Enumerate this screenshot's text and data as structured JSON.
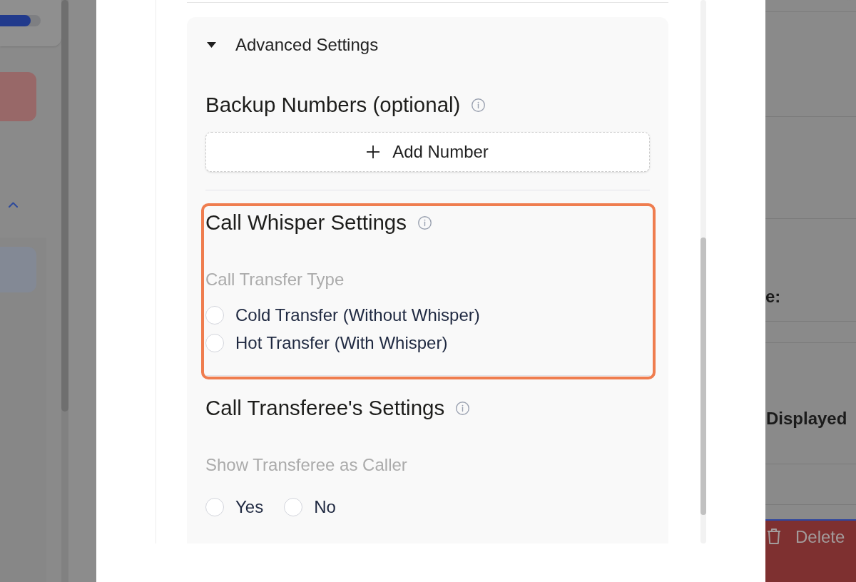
{
  "background_left": {
    "progress_bar": {
      "level": 0.75
    }
  },
  "modal": {
    "advanced_settings": {
      "label": "Advanced Settings",
      "expanded": true
    },
    "backup_numbers": {
      "title": "Backup Numbers (optional)",
      "add_button": "Add Number"
    },
    "call_whisper_settings": {
      "title": "Call Whisper Settings",
      "highlighted": true,
      "field_label": "Call Transfer Type",
      "options": [
        {
          "label": "Cold Transfer (Without Whisper)",
          "selected": false
        },
        {
          "label": "Hot Transfer (With Whisper)",
          "selected": false
        }
      ]
    },
    "call_transferee_settings": {
      "title": "Call Transferee's Settings",
      "field_label": "Show Transferee as Caller",
      "options": [
        {
          "label": "Yes",
          "selected": false
        },
        {
          "label": "No",
          "selected": false
        }
      ]
    }
  },
  "background_right": {
    "labels": [
      "e:",
      "Displayed"
    ],
    "delete_button": "Delete"
  }
}
